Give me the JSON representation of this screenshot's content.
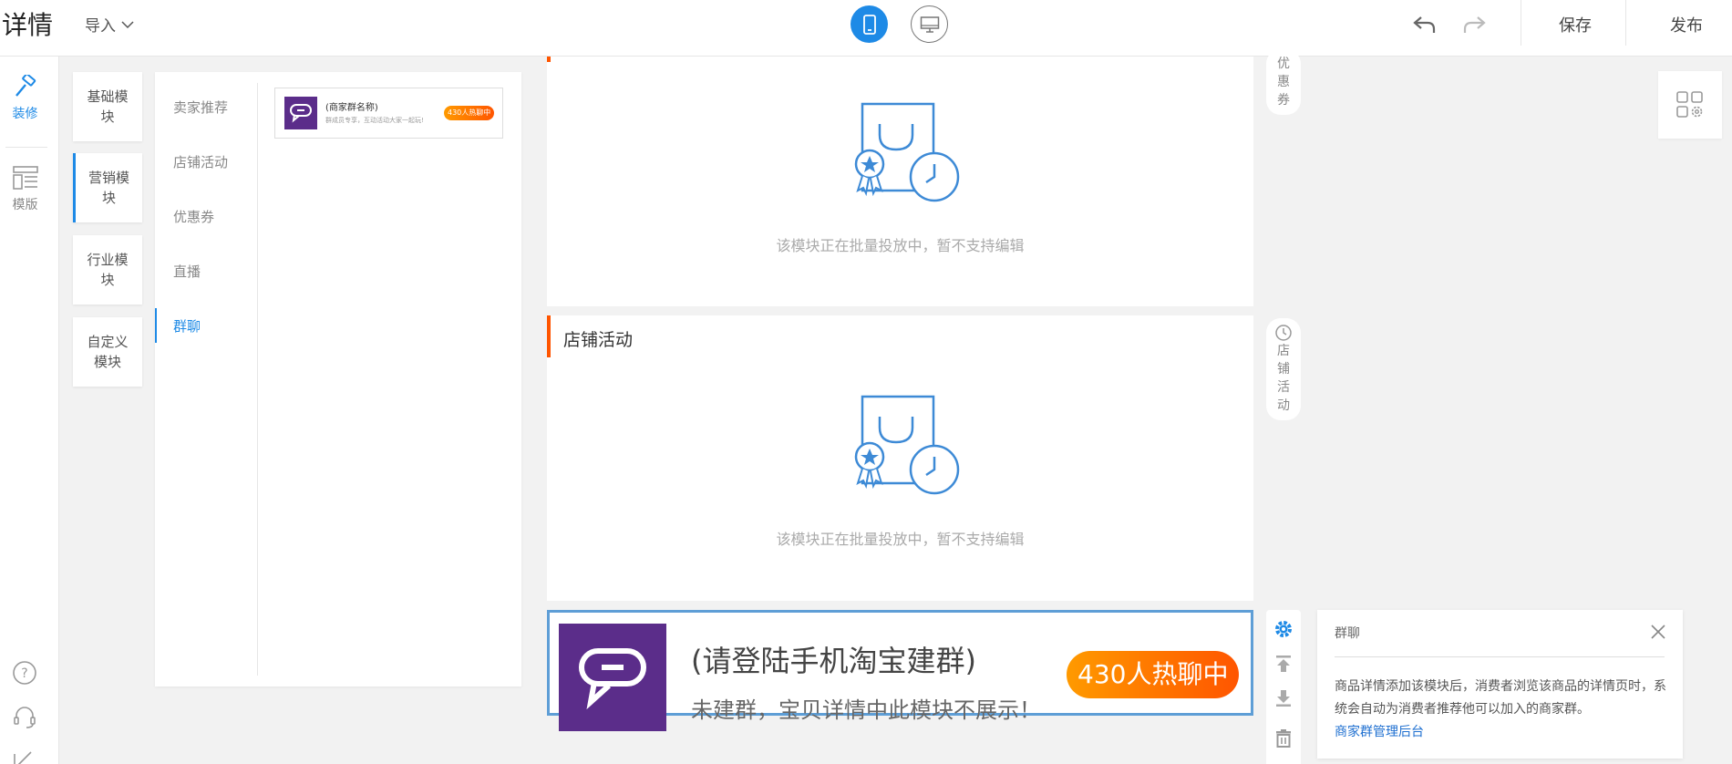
{
  "header": {
    "title": "详情",
    "import_label": "导入",
    "save_label": "保存",
    "publish_label": "发布"
  },
  "rail": {
    "decorate_label": "装修",
    "template_label": "模版"
  },
  "categories": [
    {
      "label": "基础模块"
    },
    {
      "label": "营销模块"
    },
    {
      "label": "行业模块"
    },
    {
      "label": "自定义模块"
    }
  ],
  "sub_nav": [
    {
      "label": "卖家推荐"
    },
    {
      "label": "店铺活动"
    },
    {
      "label": "优惠券"
    },
    {
      "label": "直播"
    },
    {
      "label": "群聊"
    }
  ],
  "module_card": {
    "title": "(商家群名称)",
    "subtitle": "群成员专享，互动活动大家一起玩!",
    "badge": "430人热聊中"
  },
  "canvas": {
    "placeholder_text": "该模块正在批量投放中，暂不支持编辑",
    "store_activity_title": "店铺活动",
    "groupchat": {
      "title": "(请登陆手机淘宝建群)",
      "subtitle": "未建群，宝贝详情中此模块不展示！",
      "badge": "430人热聊中"
    }
  },
  "side_labels": {
    "coupon_chars": [
      "优",
      "惠",
      "券"
    ],
    "store_activity_chars": [
      "店",
      "铺",
      "活",
      "动"
    ]
  },
  "info_panel": {
    "title": "群聊",
    "description": "商品详情添加该模块后，消费者浏览该商品的详情页时，系统会自动为消费者推荐他可以加入的商家群。",
    "link": "商家群管理后台"
  },
  "colors": {
    "accent": "#1e8ae6",
    "orange": "#ff5500",
    "purple": "#5b2d8a",
    "selection_border": "#5e9ed6"
  }
}
